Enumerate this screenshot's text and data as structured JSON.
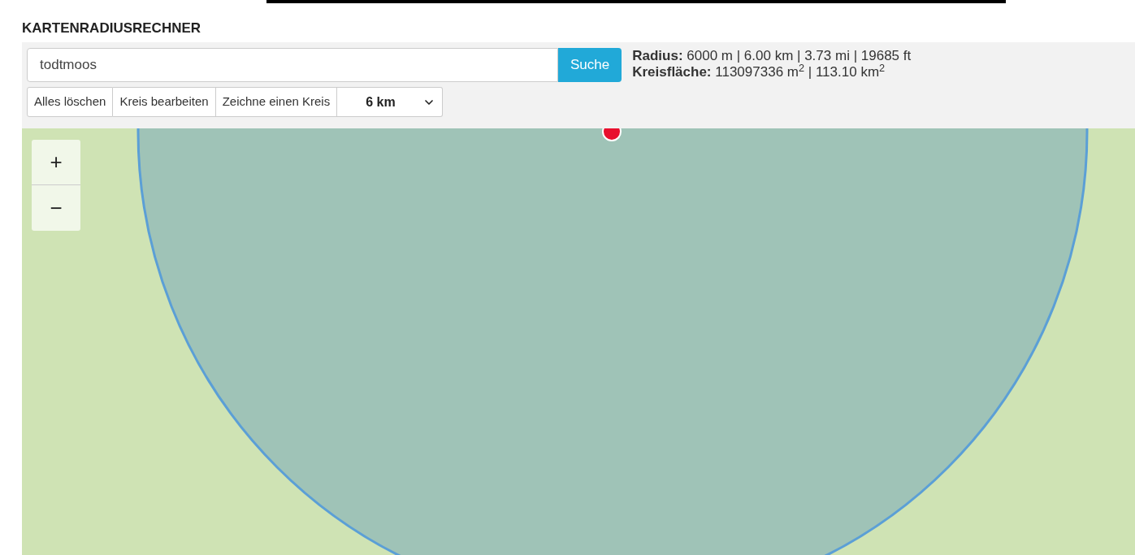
{
  "title": "KARTENRADIUSRECHNER",
  "search": {
    "value": "todtmoos",
    "button": "Suche"
  },
  "stats": [
    "**Radius:** 6000 m | 6.00 km | 3.73 mi | 19685 ft",
    "**Kreisfläche:** 113097336 m$^{2}$ | 113.10 km$^{2}$"
  ],
  "toolbar": [
    "Alles löschen",
    "Kreis bearbeiten",
    "Zeichne einen Kreis"
  ],
  "radius_select": {
    "value": "6 km"
  },
  "map": {
    "zoom_controls": [
      "+",
      "−"
    ]
  }
}
